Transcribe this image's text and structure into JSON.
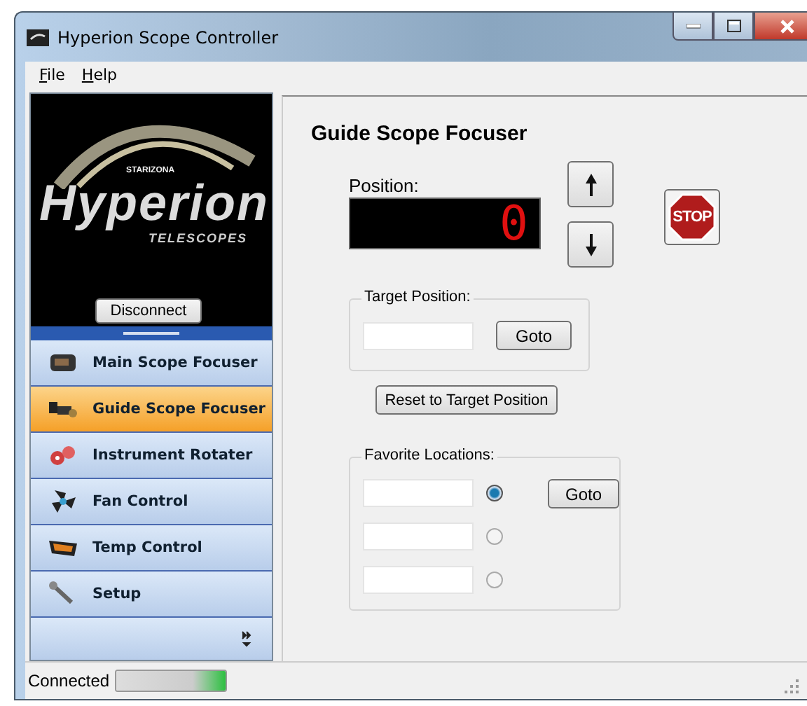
{
  "window": {
    "title": "Hyperion Scope Controller"
  },
  "menu": [
    {
      "label": "File"
    },
    {
      "label": "Help"
    }
  ],
  "logo": {
    "brand": "STARIZONA",
    "name": "Hyperion",
    "subtitle": "TELESCOPES"
  },
  "disconnect_button": "Disconnect",
  "nav": [
    {
      "label": "Main Scope Focuser",
      "selected": false
    },
    {
      "label": "Guide Scope Focuser",
      "selected": true
    },
    {
      "label": "Instrument Rotater",
      "selected": false
    },
    {
      "label": "Fan Control",
      "selected": false
    },
    {
      "label": "Temp Control",
      "selected": false
    },
    {
      "label": "Setup",
      "selected": false
    }
  ],
  "panel": {
    "title": "Guide Scope Focuser",
    "position_label": "Position:",
    "position_value": "0",
    "stop_label": "STOP",
    "target": {
      "legend": "Target Position:",
      "button": "Goto"
    },
    "reset_button": "Reset to Target Position",
    "favorites": {
      "legend": "Favorite Locations:",
      "button": "Goto",
      "rows": [
        {
          "selected": true
        },
        {
          "selected": false
        },
        {
          "selected": false
        }
      ]
    }
  },
  "status_bar": {
    "text": "Connected",
    "progress": {
      "level": 1
    }
  }
}
